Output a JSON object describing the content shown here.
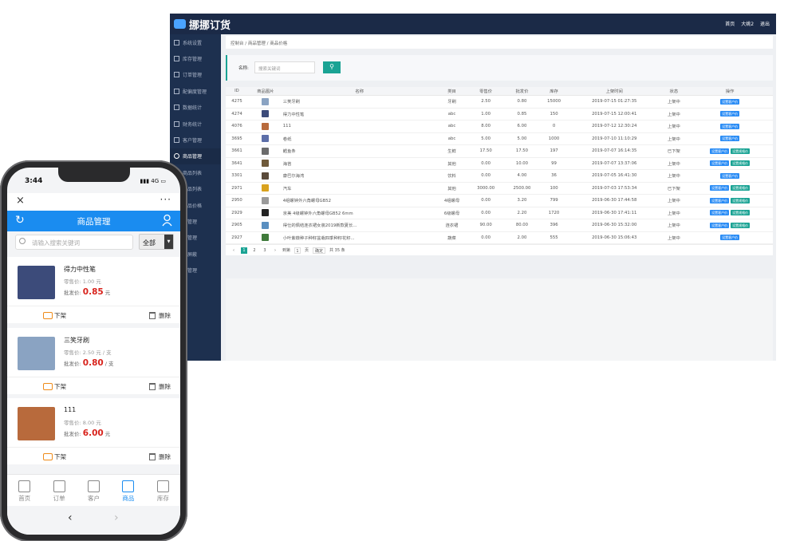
{
  "desktop": {
    "brand": "挪挪订货",
    "top_links": [
      "首页",
      "大姚2",
      "退出"
    ],
    "sidebar": [
      {
        "label": "系统设置"
      },
      {
        "label": "库存管理"
      },
      {
        "label": "订单管理"
      },
      {
        "label": "配偏度管理"
      },
      {
        "label": "数据统计"
      },
      {
        "label": "财务统计"
      },
      {
        "label": "客户管理"
      },
      {
        "label": "商品管理",
        "active": true
      },
      {
        "label": "商品列表"
      },
      {
        "label": "商品列表"
      },
      {
        "label": "商品价格"
      },
      {
        "label": "类管理"
      },
      {
        "label": "档管理"
      },
      {
        "label": "品屏蔽"
      },
      {
        "label": "牌管理"
      }
    ],
    "breadcrumb": "控制台 / 商品管理 / 商品价格",
    "search": {
      "label": "名称:",
      "placeholder": "搜索关键词"
    },
    "columns": [
      "ID",
      "商品图片",
      "名称",
      "类目",
      "零售价",
      "批发价",
      "库存",
      "上架时间",
      "状态",
      "操作"
    ],
    "rows": [
      {
        "id": "4275",
        "name": "三笑牙刷",
        "cat": "牙刷",
        "retail": "2.50",
        "wholesale": "0.80",
        "stock": "15000",
        "time": "2019-07-15 01:27:35",
        "status": "上架中",
        "btns": [
          "设置客户价"
        ],
        "color": "#8aa3c2"
      },
      {
        "id": "4274",
        "name": "得力中性笔",
        "cat": "abc",
        "retail": "1.00",
        "wholesale": "0.85",
        "stock": "150",
        "time": "2019-07-15 12:00:41",
        "status": "上架中",
        "btns": [
          "设置客户价"
        ],
        "color": "#3c4b7a"
      },
      {
        "id": "4076",
        "name": "111",
        "cat": "abc",
        "retail": "8.00",
        "wholesale": "6.00",
        "stock": "0",
        "time": "2019-07-12 12:30:24",
        "status": "上架中",
        "btns": [
          "设置客户价"
        ],
        "color": "#b86a3c"
      },
      {
        "id": "3695",
        "name": "卷纸",
        "cat": "abc",
        "retail": "5.00",
        "wholesale": "5.00",
        "stock": "1000",
        "time": "2019-07-10 11:10:29",
        "status": "上架中",
        "btns": [
          "设置客户价"
        ],
        "color": "#5c6ea8"
      },
      {
        "id": "3661",
        "name": "鳕鱼条",
        "cat": "生鲜",
        "retail": "17.50",
        "wholesale": "17.50",
        "stock": "197",
        "time": "2019-07-07 16:14:35",
        "status": "已下架",
        "btns": [
          "设置客户价",
          "设置规格价"
        ],
        "color": "#6b6b6b"
      },
      {
        "id": "3641",
        "name": "海苔",
        "cat": "其他",
        "retail": "0.00",
        "wholesale": "10.00",
        "stock": "99",
        "time": "2019-07-07 13:37:06",
        "status": "上架中",
        "btns": [
          "设置客户价",
          "设置规格价"
        ],
        "color": "#6f5a3a"
      },
      {
        "id": "3301",
        "name": "康巴尔海湾",
        "cat": "饮料",
        "retail": "0.00",
        "wholesale": "4.00",
        "stock": "36",
        "time": "2019-07-05 16:41:30",
        "status": "上架中",
        "btns": [
          "设置客户价"
        ],
        "color": "#5a4a3a"
      },
      {
        "id": "2971",
        "name": "汽车",
        "cat": "其他",
        "retail": "3000.00",
        "wholesale": "2500.00",
        "stock": "100",
        "time": "2019-07-03 17:53:34",
        "status": "已下架",
        "btns": [
          "设置客户价",
          "设置规格价"
        ],
        "color": "#d9a21e"
      },
      {
        "id": "2950",
        "name": "4组螺钟外六角螺母GB52",
        "cat": "4组螺母",
        "retail": "0.00",
        "wholesale": "3.20",
        "stock": "799",
        "time": "2019-06-30 17:44:58",
        "status": "上架中",
        "btns": [
          "设置客户价",
          "设置规格价"
        ],
        "color": "#9a9a9a"
      },
      {
        "id": "2929",
        "name": "京美 4级螺钟外六角螺母GB52 6mm",
        "cat": "6级螺母",
        "retail": "0.00",
        "wholesale": "2.20",
        "stock": "1720",
        "time": "2019-06-30 17:41:11",
        "status": "上架中",
        "btns": [
          "设置客户价",
          "设置规格价"
        ],
        "color": "#222222"
      },
      {
        "id": "2905",
        "name": "得仕的佩结连衣裙女装2019新款夏长...",
        "cat": "连衣裙",
        "retail": "90.00",
        "wholesale": "80.00",
        "stock": "396",
        "time": "2019-06-30 15:32:00",
        "status": "上架中",
        "btns": [
          "设置客户价",
          "设置规格价"
        ],
        "color": "#5a8fc0"
      },
      {
        "id": "2927",
        "name": "小叶紫薇种子种籽盆栽四季种籽花籽...",
        "cat": "蔬菜",
        "retail": "0.00",
        "wholesale": "2.00",
        "stock": "555",
        "time": "2019-06-30 15:06:43",
        "status": "上架中",
        "btns": [
          "设置客户价"
        ],
        "color": "#3f7a3a"
      }
    ],
    "pager": {
      "pages": [
        "1",
        "2",
        "3"
      ],
      "goto_label": "到第",
      "goto_value": "1",
      "page_unit": "页",
      "confirm": "确定",
      "total": "共 35 条"
    }
  },
  "phone": {
    "time": "3:44",
    "signal": "4G",
    "title": "商品管理",
    "search_placeholder": "请输入搜索关键词",
    "filter": "全部",
    "products": [
      {
        "name": "得力中性笔",
        "retail": "零售价: 1.00 元",
        "wholesale_label": "批发价:",
        "wholesale": "0.85",
        "unit": "元",
        "color": "#3c4b7a"
      },
      {
        "name": "三笑牙刷",
        "retail": "零售价: 2.50 元 / 支",
        "wholesale_label": "批发价:",
        "wholesale": "0.80",
        "unit": "/ 支",
        "color": "#8aa3c2"
      },
      {
        "name": "111",
        "retail": "零售价: 8.00 元",
        "wholesale_label": "批发价:",
        "wholesale": "6.00",
        "unit": "元",
        "color": "#b86a3c"
      }
    ],
    "actions": {
      "down": "下架",
      "delete": "删除"
    },
    "tabs": [
      {
        "label": "首页",
        "icon": "home-icon"
      },
      {
        "label": "订单",
        "icon": "order-icon"
      },
      {
        "label": "客户",
        "icon": "customer-icon"
      },
      {
        "label": "商品",
        "icon": "goods-icon",
        "active": true
      },
      {
        "label": "库存",
        "icon": "stock-icon"
      }
    ]
  }
}
